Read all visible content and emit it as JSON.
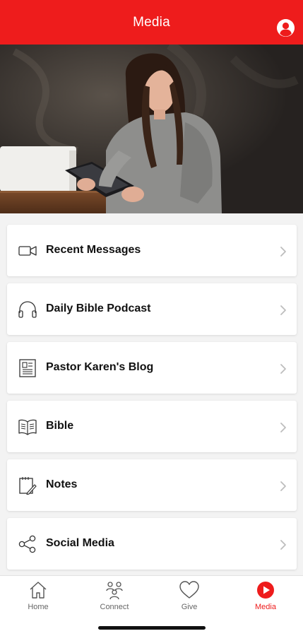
{
  "header": {
    "title": "Media",
    "profile_icon": "user-circle-icon"
  },
  "hero": {
    "image": "woman-reading-tablet-photo"
  },
  "menu": [
    {
      "label": "Recent Messages",
      "icon": "video-camera-icon"
    },
    {
      "label": "Daily Bible Podcast",
      "icon": "headphones-icon"
    },
    {
      "label": "Pastor Karen's Blog",
      "icon": "article-icon"
    },
    {
      "label": "Bible",
      "icon": "open-book-icon"
    },
    {
      "label": "Notes",
      "icon": "notepad-pencil-icon"
    },
    {
      "label": "Social Media",
      "icon": "share-icon"
    }
  ],
  "tabs": [
    {
      "label": "Home",
      "icon": "home-icon",
      "active": false
    },
    {
      "label": "Connect",
      "icon": "people-icon",
      "active": false
    },
    {
      "label": "Give",
      "icon": "heart-icon",
      "active": false
    },
    {
      "label": "Media",
      "icon": "play-circle-icon",
      "active": true
    }
  ],
  "colors": {
    "accent": "#ee1c1c",
    "text": "#111111",
    "muted": "#666666",
    "background": "#f3f3f3"
  }
}
